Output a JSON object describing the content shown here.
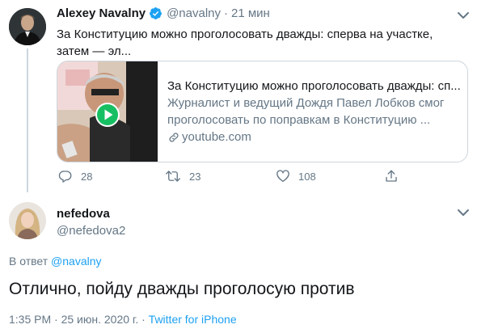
{
  "tweet1": {
    "name": "Alexey Navalny",
    "handle": "@navalny",
    "separator": "·",
    "time": "21 мин",
    "text": "За Конституцию можно проголосовать дважды: сперва на участке, затем — эл...",
    "card": {
      "title": "За Конституцию можно проголосовать дважды: сп...",
      "description": "Журналист и ведущий Дождя Павел Лобков смог проголосовать по поправкам в Конституцию ...",
      "domain": "youtube.com"
    },
    "actions": {
      "replies": "28",
      "retweets": "23",
      "likes": "108"
    }
  },
  "tweet2": {
    "name": "nefedova",
    "handle": "@nefedova2",
    "reply_prefix": "В ответ",
    "reply_mention": "@navalny",
    "text": "Отлично, пойду дважды проголосую против",
    "time": "1:35 PM",
    "separator1": "·",
    "date": "25 июн. 2020 г.",
    "separator2": "·",
    "source": "Twitter for iPhone"
  },
  "colors": {
    "accent": "#1da1f2",
    "secondary_text": "#657786",
    "border": "#ccd6dd",
    "play_button": "#17bf63"
  },
  "icons": [
    "verified-badge-icon",
    "chevron-down-icon",
    "play-icon",
    "link-icon",
    "reply-icon",
    "retweet-icon",
    "like-icon",
    "share-icon"
  ]
}
